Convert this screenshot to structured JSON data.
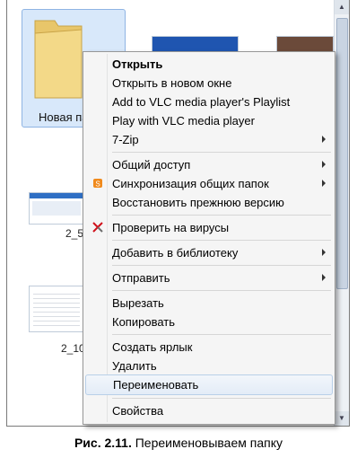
{
  "background": {
    "folder_label": "Новая па",
    "file_labels": [
      "2_5",
      "2_10"
    ]
  },
  "menu": {
    "items": [
      {
        "label": "Открыть",
        "bold": true,
        "submenu": false,
        "icon": null
      },
      {
        "label": "Открыть в новом окне",
        "submenu": false,
        "icon": null
      },
      {
        "label": "Add to VLC media player's Playlist",
        "submenu": false,
        "icon": null
      },
      {
        "label": "Play with VLC media player",
        "submenu": false,
        "icon": null
      },
      {
        "label": "7-Zip",
        "submenu": true,
        "icon": null
      },
      {
        "label": "Общий доступ",
        "submenu": true,
        "icon": null
      },
      {
        "label": "Синхронизация общих папок",
        "submenu": true,
        "icon": "sync-icon"
      },
      {
        "label": "Восстановить прежнюю версию",
        "submenu": false,
        "icon": null
      },
      {
        "label": "Проверить на вирусы",
        "submenu": false,
        "icon": "antivirus-icon"
      },
      {
        "label": "Добавить в библиотеку",
        "submenu": true,
        "icon": null
      },
      {
        "label": "Отправить",
        "submenu": true,
        "icon": null
      },
      {
        "label": "Вырезать",
        "submenu": false,
        "icon": null
      },
      {
        "label": "Копировать",
        "submenu": false,
        "icon": null
      },
      {
        "label": "Создать ярлык",
        "submenu": false,
        "icon": null
      },
      {
        "label": "Удалить",
        "submenu": false,
        "icon": null
      },
      {
        "label": "Переименовать",
        "submenu": false,
        "icon": null,
        "highlighted": true
      },
      {
        "label": "Свойства",
        "submenu": false,
        "icon": null
      }
    ]
  },
  "caption": {
    "number": "Рис. 2.11.",
    "text": "Переименовываем папку"
  },
  "colors": {
    "highlight": "#e3ecf7",
    "menu_bg": "#f5f5f5"
  }
}
